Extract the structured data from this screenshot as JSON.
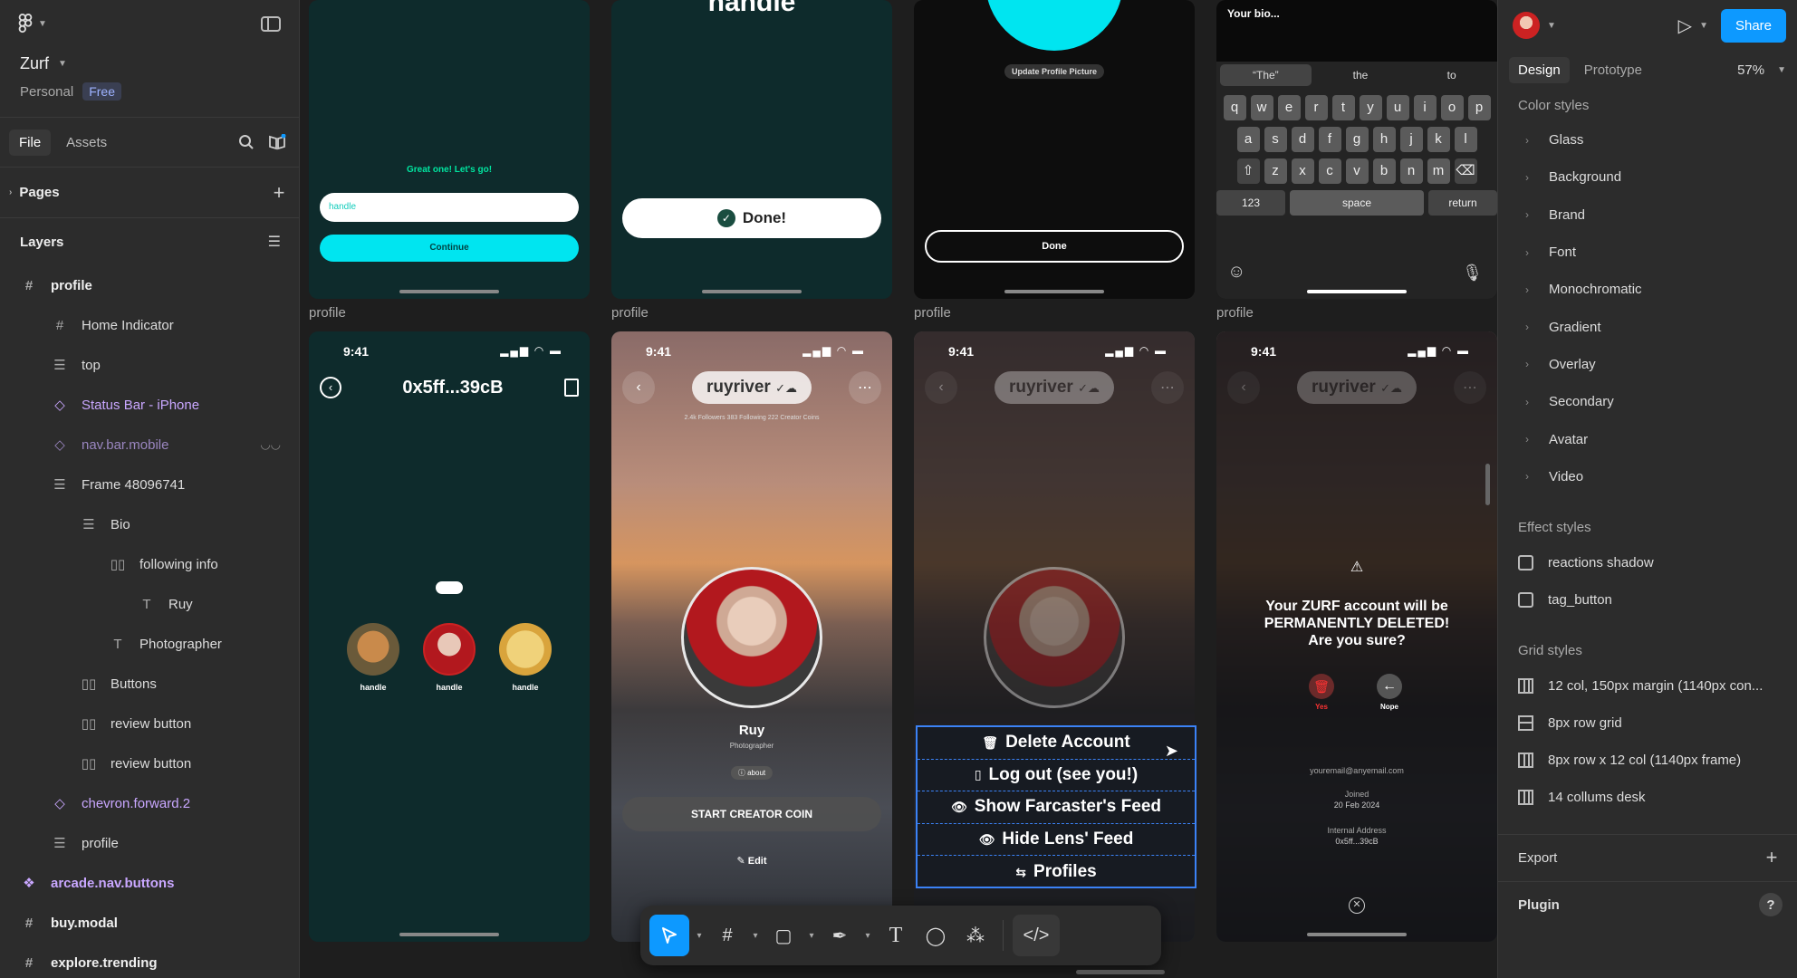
{
  "project": {
    "name": "Zurf",
    "team": "Personal",
    "plan": "Free"
  },
  "left_tabs": {
    "file": "File",
    "assets": "Assets"
  },
  "pages": {
    "label": "Pages"
  },
  "layers": {
    "label": "Layers",
    "items": [
      {
        "label": "profile",
        "icon": "frame-icon"
      },
      {
        "label": "Home Indicator",
        "icon": "frame-icon"
      },
      {
        "label": "top",
        "icon": "group-icon"
      },
      {
        "label": "Status Bar - iPhone",
        "icon": "component-instance-icon"
      },
      {
        "label": "nav.bar.mobile",
        "icon": "component-instance-icon"
      },
      {
        "label": "Frame 48096741",
        "icon": "group-icon"
      },
      {
        "label": "Bio",
        "icon": "group-icon"
      },
      {
        "label": "following info",
        "icon": "autolayout-icon"
      },
      {
        "label": "Ruy",
        "icon": "text-icon"
      },
      {
        "label": "Photographer",
        "icon": "text-icon"
      },
      {
        "label": "Buttons",
        "icon": "autolayout-icon"
      },
      {
        "label": "review button",
        "icon": "autolayout-icon"
      },
      {
        "label": "review button",
        "icon": "autolayout-icon"
      },
      {
        "label": "chevron.forward.2",
        "icon": "component-instance-icon"
      },
      {
        "label": "profile",
        "icon": "group-icon"
      },
      {
        "label": "arcade.nav.buttons",
        "icon": "component-icon"
      },
      {
        "label": "buy.modal",
        "icon": "frame-icon"
      },
      {
        "label": "explore.trending",
        "icon": "frame-icon"
      }
    ]
  },
  "canvas": {
    "frame_label": "profile",
    "f1": {
      "prompt": "Great one! Let's go!",
      "input": "handle",
      "button": "Continue"
    },
    "f2": {
      "title": "handle",
      "done": "Done!"
    },
    "f3": {
      "update": "Update Profile Picture",
      "done": "Done"
    },
    "f4": {
      "bio_placeholder": "Your bio...",
      "suggestions": [
        "“The”",
        "the",
        "to"
      ],
      "row1": [
        "q",
        "w",
        "e",
        "r",
        "t",
        "y",
        "u",
        "i",
        "o",
        "p"
      ],
      "row2": [
        "a",
        "s",
        "d",
        "f",
        "g",
        "h",
        "j",
        "k",
        "l"
      ],
      "row3": [
        "z",
        "x",
        "c",
        "v",
        "b",
        "n",
        "m"
      ],
      "num": "123",
      "space": "space",
      "return": "return"
    },
    "time": "9:41",
    "wallet": {
      "address": "0x5ff...39cB",
      "friends": [
        "handle",
        "handle",
        "handle"
      ]
    },
    "profile": {
      "handle": "ruyriver",
      "stats": "2.4k Followers   383 Following   222 Creator Coins",
      "name": "Ruy",
      "role": "Photographer",
      "about": "about",
      "cta": "START CREATOR COIN",
      "edit": "Edit"
    },
    "menu": [
      "Delete Account",
      "Log out (see you!)",
      "Show Farcaster's Feed",
      "Hide Lens' Feed",
      "Profiles"
    ],
    "delete_dialog": {
      "line1": "Your ZURF account will be",
      "line2": "PERMANENTLY DELETED!",
      "line3": "Are you sure?",
      "yes": "Yes",
      "nope": "Nope",
      "email": "youremail@anyemail.com",
      "joined_label": "Joined",
      "joined_date": "20 Feb 2024",
      "internal_label": "Internal Address",
      "internal_value": "0x5ff...39cB"
    }
  },
  "right": {
    "share": "Share",
    "tabs": {
      "design": "Design",
      "prototype": "Prototype"
    },
    "zoom": "57%",
    "color_styles_title": "Color styles",
    "color_styles": [
      "Glass",
      "Background",
      "Brand",
      "Font",
      "Monochromatic",
      "Gradient",
      "Overlay",
      "Secondary",
      "Avatar",
      "Video"
    ],
    "effect_styles_title": "Effect styles",
    "effect_styles": [
      "reactions shadow",
      "tag_button"
    ],
    "grid_styles_title": "Grid styles",
    "grid_styles": [
      "12 col, 150px margin (1140px con...",
      "8px row grid",
      "8px row x 12 col (1140px frame)",
      "14 collums desk"
    ],
    "export": "Export",
    "plugin": "Plugin"
  },
  "colors": {
    "accent": "#0d99ff",
    "cyan": "#00e5f0",
    "frame_bg": "#0e2b2c",
    "selection": "#3b82f6"
  }
}
